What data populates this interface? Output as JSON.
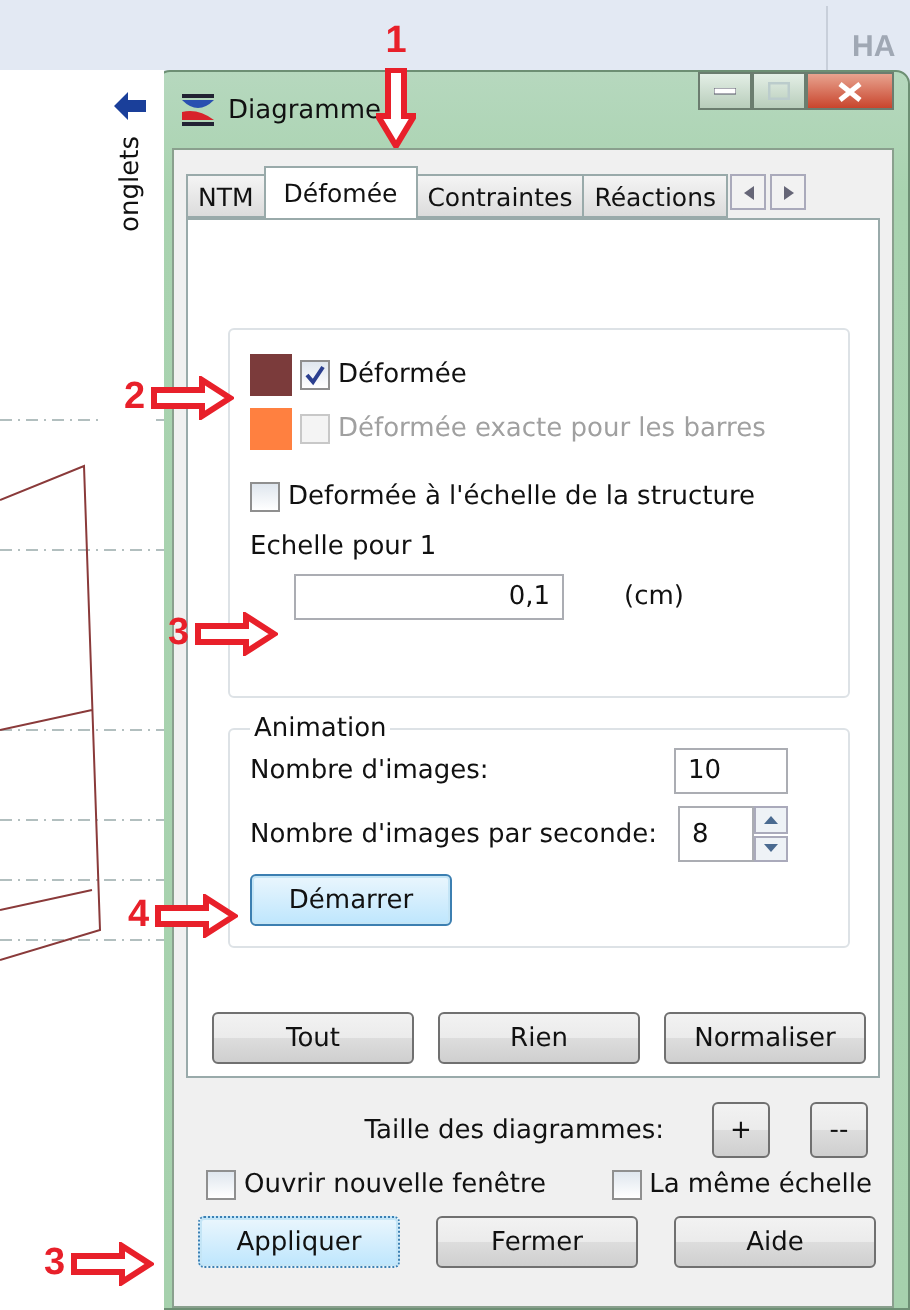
{
  "background": {
    "header_text": "HA",
    "side_tab": {
      "label": "onglets"
    }
  },
  "window": {
    "title": "Diagramme"
  },
  "tabs": [
    {
      "label": "NTM",
      "selected": false
    },
    {
      "label": "Défomée",
      "selected": true
    },
    {
      "label": "Contraintes",
      "selected": false
    },
    {
      "label": "Réactions",
      "selected": false
    }
  ],
  "options": [
    {
      "label": "Déformée",
      "checked": true,
      "disabled": false,
      "color": "#7b3b3b"
    },
    {
      "label": "Déformée exacte pour les barres",
      "checked": false,
      "disabled": true,
      "color": "#ff8040"
    }
  ],
  "scale_option": {
    "label": "Deformée à l'échelle de la structure",
    "checked": false
  },
  "scale": {
    "label": "Echelle pour 1",
    "value": "0,1",
    "unit": "(cm)"
  },
  "animation": {
    "title": "Animation",
    "images_label": "Nombre d'images:",
    "images_value": "10",
    "rate_label": "Nombre d'images par seconde:",
    "rate_value": "8",
    "start_button": "Démarrer"
  },
  "panel_buttons": [
    "Tout",
    "Rien",
    "Normaliser"
  ],
  "size": {
    "label": "Taille des diagrammes:",
    "buttons": [
      "+",
      "--"
    ]
  },
  "bottom_options": [
    {
      "label": "Ouvrir nouvelle fenêtre",
      "checked": false
    },
    {
      "label": "La même échelle",
      "checked": false
    }
  ],
  "dialog_buttons": [
    {
      "label": "Appliquer",
      "selected": true
    },
    {
      "label": "Fermer",
      "selected": false
    },
    {
      "label": "Aide",
      "selected": false
    }
  ],
  "annotations": [
    {
      "label": "1",
      "kind": "down"
    },
    {
      "label": "2",
      "kind": "right"
    },
    {
      "label": "3",
      "kind": "right"
    },
    {
      "label": "4",
      "kind": "right"
    },
    {
      "label": "3",
      "kind": "right"
    }
  ]
}
